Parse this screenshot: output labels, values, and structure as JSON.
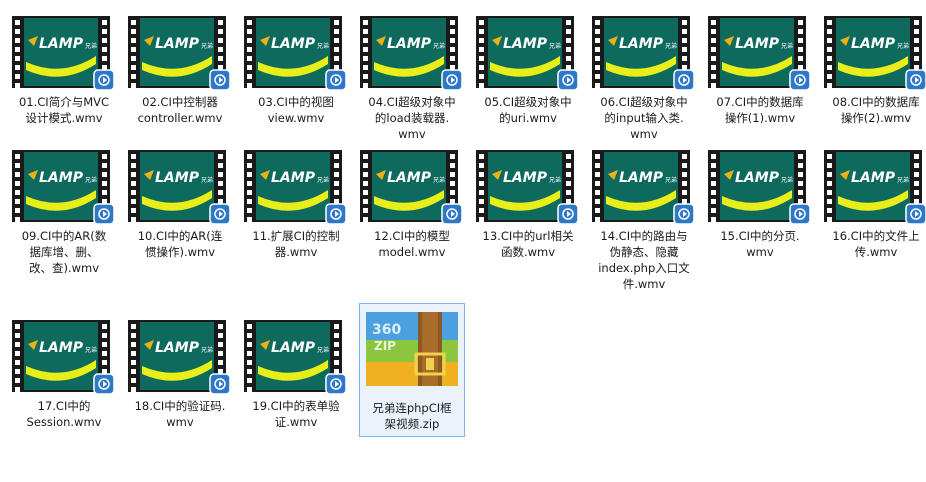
{
  "files": [
    {
      "name": "01.CI简介与MVC设计模式.wmv",
      "type": "video"
    },
    {
      "name": "02.CI中控制器controller.wmv",
      "type": "video"
    },
    {
      "name": "03.CI中的视图view.wmv",
      "type": "video"
    },
    {
      "name": "04.CI超级对象中的load装载器.wmv",
      "type": "video"
    },
    {
      "name": "05.CI超级对象中的uri.wmv",
      "type": "video"
    },
    {
      "name": "06.CI超级对象中的input输入类.wmv",
      "type": "video"
    },
    {
      "name": "07.CI中的数据库操作(1).wmv",
      "type": "video"
    },
    {
      "name": "08.CI中的数据库操作(2).wmv",
      "type": "video"
    },
    {
      "name": "09.CI中的AR(数据库增、删、改、查).wmv",
      "type": "video"
    },
    {
      "name": "10.CI中的AR(连惯操作).wmv",
      "type": "video"
    },
    {
      "name": "11.扩展CI的控制器.wmv",
      "type": "video"
    },
    {
      "name": "12.CI中的模型model.wmv",
      "type": "video"
    },
    {
      "name": "13.CI中的url相关函数.wmv",
      "type": "video"
    },
    {
      "name": "14.CI中的路由与伪静态、隐藏index.php入口文件.wmv",
      "type": "video"
    },
    {
      "name": "15.CI中的分页.wmv",
      "type": "video"
    },
    {
      "name": "16.CI中的文件上传.wmv",
      "type": "video"
    },
    {
      "name": "17.CI中的Session.wmv",
      "type": "video"
    },
    {
      "name": "18.CI中的验证码.wmv",
      "type": "video"
    },
    {
      "name": "19.CI中的表单验证.wmv",
      "type": "video"
    },
    {
      "name": "兄弟连phpCI框架视频.zip",
      "type": "zip",
      "selected": true
    }
  ],
  "labels": [
    [
      "01.CI简介与MVC",
      "设计模式.wmv"
    ],
    [
      "02.CI中控制器",
      "controller.wmv"
    ],
    [
      "03.CI中的视图",
      "view.wmv"
    ],
    [
      "04.CI超级对象中",
      "的load装载器.",
      "wmv"
    ],
    [
      "05.CI超级对象中",
      "的uri.wmv"
    ],
    [
      "06.CI超级对象中",
      "的input输入类.",
      "wmv"
    ],
    [
      "07.CI中的数据库",
      "操作(1).wmv"
    ],
    [
      "08.CI中的数据库",
      "操作(2).wmv"
    ],
    [
      "09.CI中的AR(数",
      "据库增、删、",
      "改、查).wmv"
    ],
    [
      "10.CI中的AR(连",
      "惯操作).wmv"
    ],
    [
      "11.扩展CI的控制",
      "器.wmv"
    ],
    [
      "12.CI中的模型",
      "model.wmv"
    ],
    [
      "13.CI中的url相关",
      "函数.wmv"
    ],
    [
      "14.CI中的路由与",
      "伪静态、隐藏",
      "index.php入口文",
      "件.wmv"
    ],
    [
      "15.CI中的分页.",
      "wmv"
    ],
    [
      "16.CI中的文件上",
      "传.wmv"
    ],
    [
      "17.CI中的",
      "Session.wmv"
    ],
    [
      "18.CI中的验证码.",
      "wmv"
    ],
    [
      "19.CI中的表单验",
      "证.wmv"
    ],
    [
      "兄弟连phpCI框",
      "架视频.zip"
    ]
  ],
  "thumb_brand": "LAMP",
  "thumb_brand_small": "兄弟",
  "zip_brand": "360",
  "zip_brand_sub": "ZIP",
  "colors": {
    "thumb_bg": "#0f6a5e",
    "thumb_arc": "#e8ee1a",
    "film": "#1a1a1a",
    "badge": "#2f78c8",
    "selection": "#7eb4ea"
  }
}
